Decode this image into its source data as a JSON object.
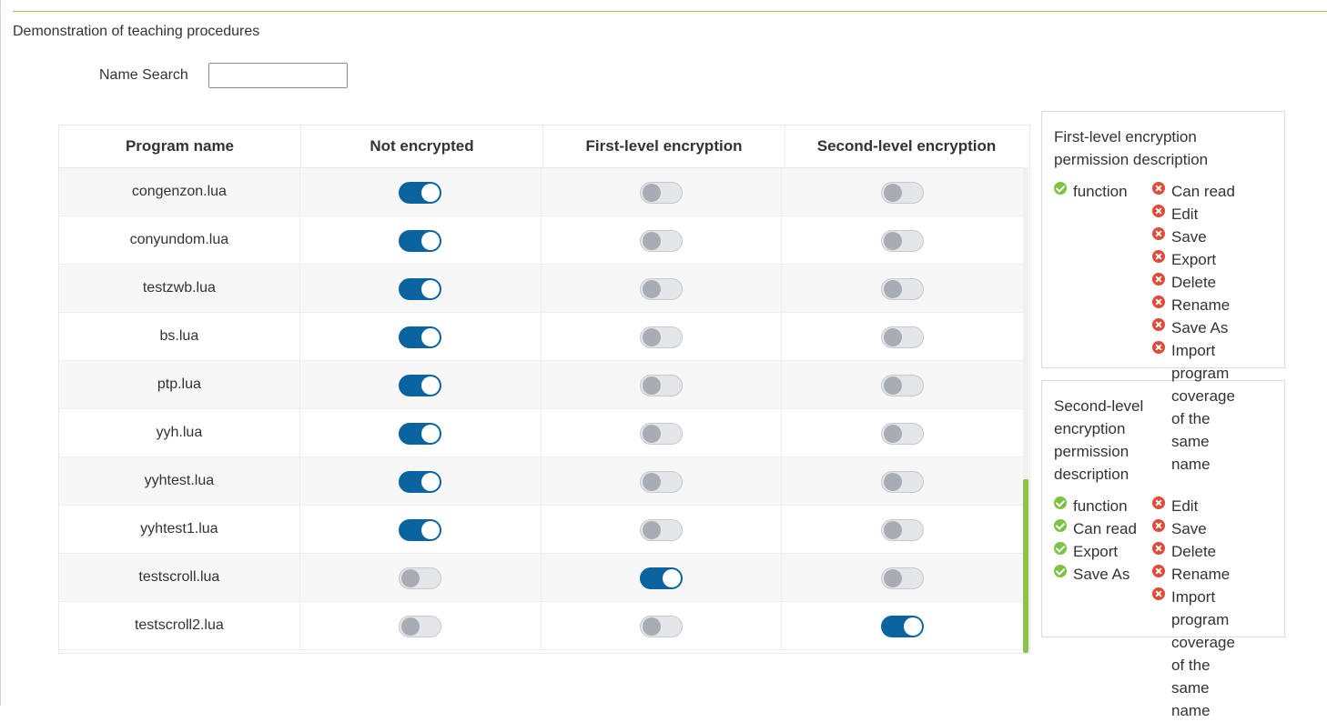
{
  "page": {
    "title": "Demonstration of teaching procedures"
  },
  "search": {
    "label": "Name Search",
    "value": "",
    "placeholder": ""
  },
  "table": {
    "headers": [
      "Program name",
      "Not encrypted",
      "First-level encryption",
      "Second-level encryption"
    ],
    "rows": [
      {
        "name": "congenzon.lua",
        "not_encrypted": true,
        "first_level": false,
        "second_level": false
      },
      {
        "name": "conyundom.lua",
        "not_encrypted": true,
        "first_level": false,
        "second_level": false
      },
      {
        "name": "testzwb.lua",
        "not_encrypted": true,
        "first_level": false,
        "second_level": false
      },
      {
        "name": "bs.lua",
        "not_encrypted": true,
        "first_level": false,
        "second_level": false
      },
      {
        "name": "ptp.lua",
        "not_encrypted": true,
        "first_level": false,
        "second_level": false
      },
      {
        "name": "yyh.lua",
        "not_encrypted": true,
        "first_level": false,
        "second_level": false
      },
      {
        "name": "yyhtest.lua",
        "not_encrypted": true,
        "first_level": false,
        "second_level": false
      },
      {
        "name": "yyhtest1.lua",
        "not_encrypted": true,
        "first_level": false,
        "second_level": false
      },
      {
        "name": "testscroll.lua",
        "not_encrypted": false,
        "first_level": true,
        "second_level": false
      },
      {
        "name": "testscroll2.lua",
        "not_encrypted": false,
        "first_level": false,
        "second_level": true
      }
    ]
  },
  "colors": {
    "switch_on": "#0a64a0",
    "switch_off": "#e4e6ea",
    "allowed": "#7cc243",
    "denied": "#dd4b39",
    "scrollbar": "#8bc34a",
    "top_rule": "#b4bd4a"
  },
  "first_level_panel": {
    "title_line1": "First-level encryption",
    "title_line2": "permission description",
    "allowed": [
      "function"
    ],
    "denied": [
      "Can read",
      "Edit",
      "Save",
      "Export",
      "Delete",
      "Rename",
      "Save As",
      "Import program coverage of the same name"
    ]
  },
  "second_level_panel": {
    "title_line1": "Second-level",
    "title_line2": "encryption",
    "title_line3": "permission",
    "title_line4": "description",
    "allowed": [
      "function",
      "Can read",
      "Export",
      "Save As"
    ],
    "denied": [
      "Edit",
      "Save",
      "Delete",
      "Rename",
      "Import program coverage of the same name"
    ]
  },
  "icons": {
    "allowed": "check-circle-icon",
    "denied": "x-circle-icon"
  }
}
